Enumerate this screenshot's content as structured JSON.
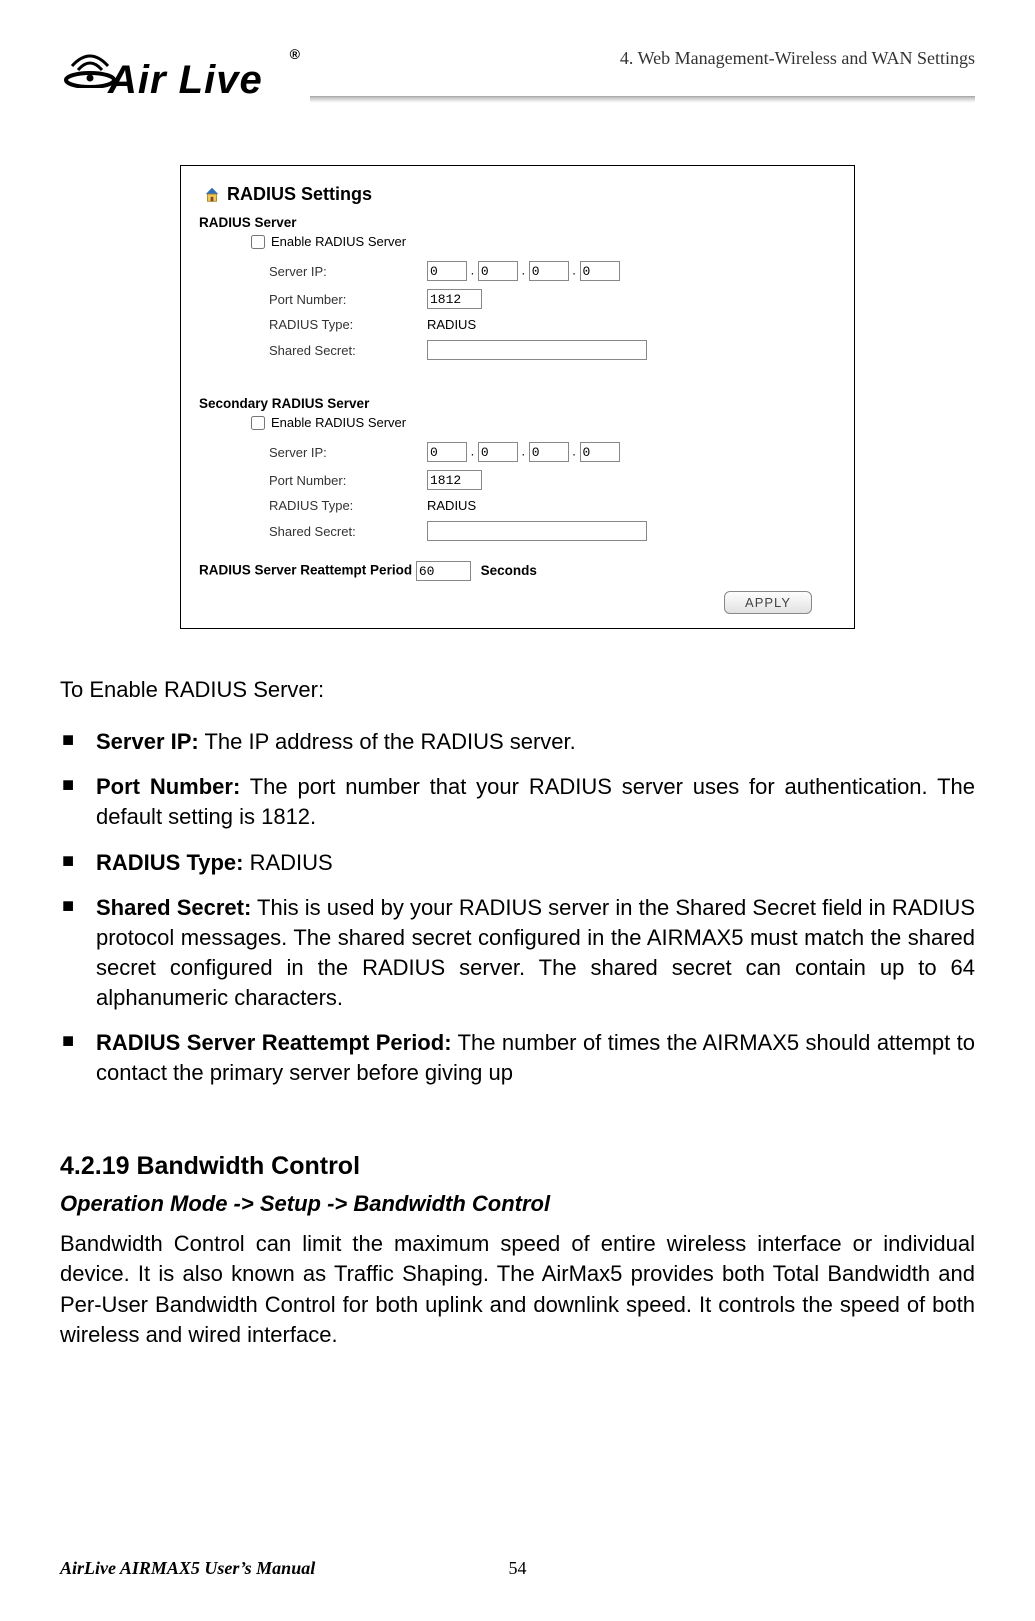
{
  "header": {
    "section_label": "4. Web Management-Wireless and WAN Settings",
    "logo_text": "Air Live",
    "logo_reg": "®"
  },
  "panel": {
    "title": "RADIUS Settings",
    "primary_head": "RADIUS Server",
    "secondary_head": "Secondary RADIUS Server",
    "enable_label": "Enable RADIUS Server",
    "labels": {
      "server_ip": "Server IP:",
      "port": "Port Number:",
      "type": "RADIUS Type:",
      "secret": "Shared Secret:"
    },
    "primary": {
      "ip": [
        "0",
        "0",
        "0",
        "0"
      ],
      "port": "1812",
      "type": "RADIUS",
      "secret": ""
    },
    "secondary": {
      "ip": [
        "0",
        "0",
        "0",
        "0"
      ],
      "port": "1812",
      "type": "RADIUS",
      "secret": ""
    },
    "reattempt_label_prefix": "RADIUS Server Reattempt Period",
    "reattempt_value": "60",
    "reattempt_label_suffix": "Seconds",
    "apply_label": "APPLY"
  },
  "body": {
    "intro": "To Enable RADIUS Server:",
    "bullets": [
      {
        "lead": "Server IP:",
        "text": " The IP address of the RADIUS server."
      },
      {
        "lead": "Port Number:",
        "text": " The port number that your RADIUS server uses for authentication. The default setting is 1812."
      },
      {
        "lead": "RADIUS Type:",
        "text": " RADIUS"
      },
      {
        "lead": "Shared Secret:",
        "text": " This is used by your RADIUS server in the Shared Secret field in RADIUS protocol messages. The shared secret configured in the AIRMAX5 must match the shared secret configured in the RADIUS server. The shared secret can contain up to 64 alphanumeric characters."
      },
      {
        "lead": "RADIUS Server Reattempt Period:",
        "text": " The number of times the AIRMAX5 should attempt to contact the primary server before giving up"
      }
    ],
    "section_num": "4.2.19 Bandwidth Control",
    "breadcrumb": "Operation Mode -> Setup -> Bandwidth Control",
    "para": "Bandwidth Control can limit the maximum speed of entire wireless interface or individual device.   It is also known as Traffic Shaping.   The AirMax5 provides both Total Bandwidth and Per-User Bandwidth Control for both uplink and downlink speed.   It controls the speed of both wireless and wired interface."
  },
  "footer": {
    "manual": "AirLive AIRMAX5 User’s Manual",
    "page": "54"
  }
}
